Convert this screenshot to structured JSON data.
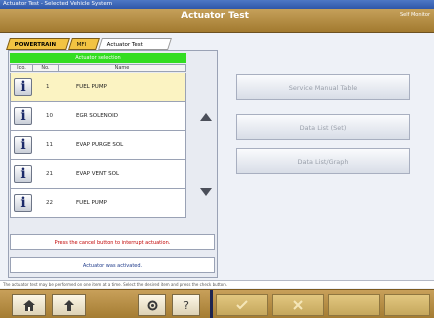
{
  "window": {
    "title": "Actuator Test - Selected Vehicle System"
  },
  "header": {
    "title": "Actuator Test",
    "right_label": "Self Monitor"
  },
  "tabs": [
    {
      "label": "POWERTRAIN"
    },
    {
      "label": "MFI"
    },
    {
      "label": "Actuator Test"
    }
  ],
  "list": {
    "select_header": "Actuator selection",
    "columns": {
      "col1": "Ico.",
      "no": "No.",
      "name": "Name"
    },
    "rows": [
      {
        "no": "1",
        "name": "FUEL PUMP"
      },
      {
        "no": "10",
        "name": "EGR SOLENOID"
      },
      {
        "no": "11",
        "name": "EVAP PURGE SOL"
      },
      {
        "no": "21",
        "name": "EVAP VENT SOL"
      },
      {
        "no": "22",
        "name": "FUEL PUMP"
      }
    ]
  },
  "messages": {
    "error": "Press the cancel button to interrupt actuation.",
    "info": "Actuator was activated."
  },
  "status_bar": "The actuator test may be performed on one item at a time. Select the desired item and press the check button.",
  "buttons": {
    "service_manual": "Service Manual Table",
    "data_list": "Data List (Set)",
    "data_list_graph": "Data List/Graph"
  },
  "footer": {
    "home_icon": "home-icon",
    "back_icon": "back-arrow-icon",
    "settings_icon": "settings-icon",
    "help_label": "?",
    "check_icon": "check-icon",
    "close_icon": "x-icon"
  }
}
